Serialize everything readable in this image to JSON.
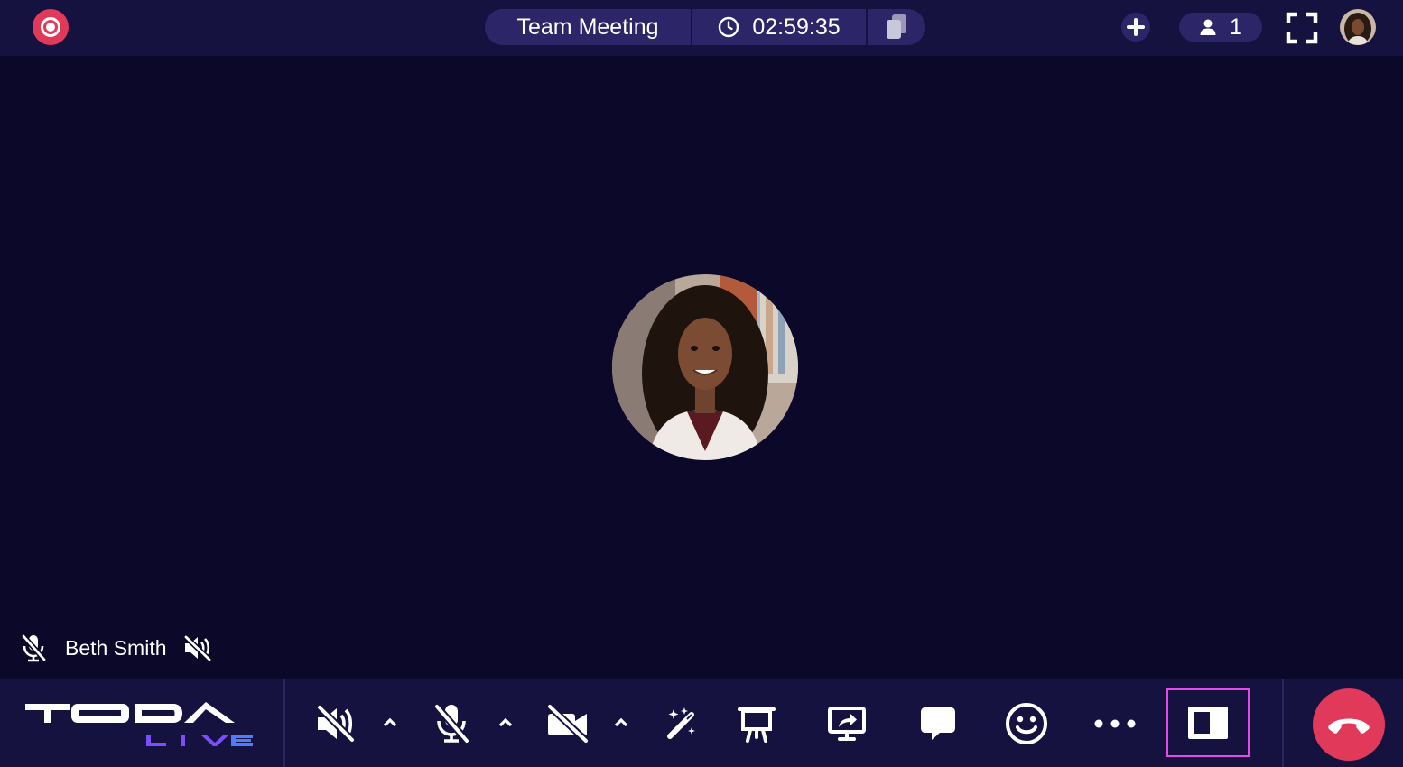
{
  "meeting": {
    "title": "Team Meeting",
    "timer": "02:59:35"
  },
  "participants": {
    "count": "1"
  },
  "stage": {
    "participant_name": "Beth Smith"
  },
  "colors": {
    "background": "#0b0829",
    "bar": "#16123f",
    "pill": "#2c2668",
    "record_red": "#e0395a",
    "highlight_magenta": "#e14be6",
    "logo_violet": "#7b4dff"
  },
  "toolbar": {
    "controls": [
      {
        "icon": "speaker-muted-icon"
      },
      {
        "icon": "microphone-muted-icon"
      },
      {
        "icon": "camera-off-icon"
      },
      {
        "icon": "magic-wand-icon"
      },
      {
        "icon": "whiteboard-icon"
      },
      {
        "icon": "screen-share-icon"
      },
      {
        "icon": "chat-icon"
      },
      {
        "icon": "emoji-icon"
      },
      {
        "icon": "more-icon"
      },
      {
        "icon": "layout-icon"
      },
      {
        "icon": "hang-up-icon"
      }
    ]
  }
}
